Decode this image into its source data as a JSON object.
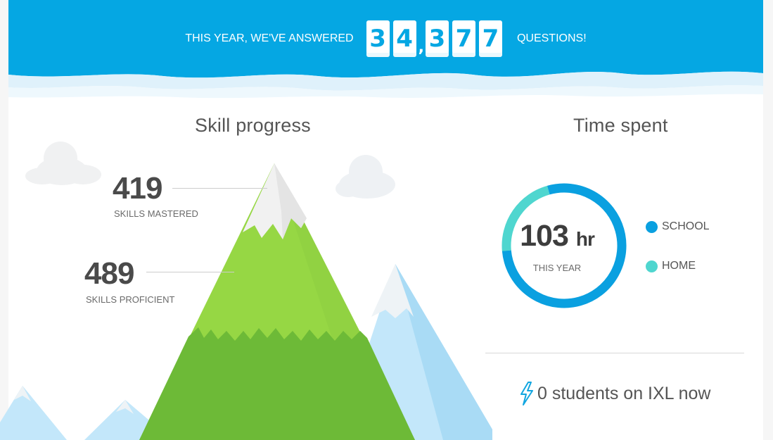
{
  "banner": {
    "prefix": "THIS YEAR, WE'VE ANSWERED",
    "digits": [
      "3",
      "4",
      "3",
      "7",
      "7"
    ],
    "comma": ",",
    "suffix": "QUESTIONS!"
  },
  "skills": {
    "title": "Skill progress",
    "mastered": {
      "value": "419",
      "label": "SKILLS MASTERED"
    },
    "proficient": {
      "value": "489",
      "label": "SKILLS PROFICIENT"
    }
  },
  "time": {
    "title": "Time spent",
    "value": "103",
    "unit": "hr",
    "caption": "THIS YEAR",
    "school_fraction": 0.78,
    "home_fraction": 0.22,
    "legend": [
      {
        "label": "SCHOOL",
        "color": "#0aa0e0"
      },
      {
        "label": "HOME",
        "color": "#4fd6cf"
      }
    ]
  },
  "online": {
    "icon": "lightning-bolt-icon",
    "text": "0 students on IXL now"
  },
  "colors": {
    "banner_blue": "#05a7e3",
    "mountain_green": "#96d744",
    "forest_green": "#6dba37",
    "snow": "#f1f1f1",
    "far_mountain": "#bfe6fa"
  }
}
